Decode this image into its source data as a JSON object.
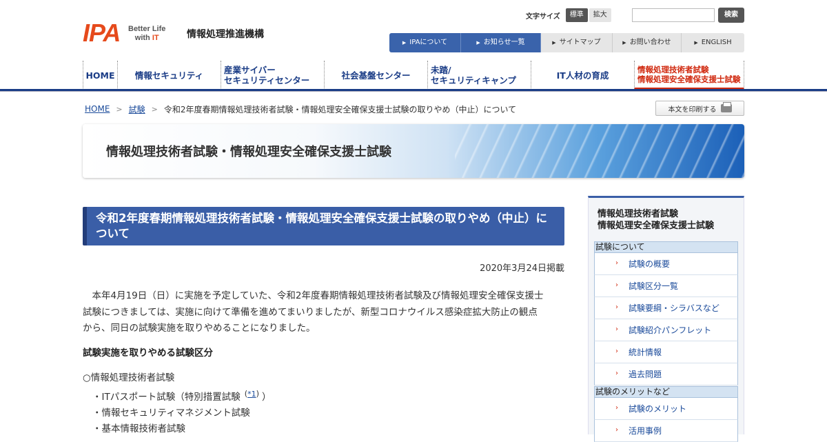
{
  "header": {
    "logo_mark": "IPA",
    "logo_tagline_1": "Better Life",
    "logo_tagline_2": "with",
    "logo_tagline_it": "IT",
    "org_name": "情報処理推進機構",
    "font_size_label": "文字サイズ",
    "font_standard": "標準",
    "font_large": "拡大",
    "search_placeholder": "",
    "search_button": "検索"
  },
  "top_nav": [
    {
      "label": "IPAについて",
      "active": true
    },
    {
      "label": "お知らせ一覧",
      "active": true
    },
    {
      "label": "サイトマップ",
      "active": false
    },
    {
      "label": "お問い合わせ",
      "active": false
    },
    {
      "label": "ENGLISH",
      "active": false
    }
  ],
  "main_nav": {
    "home": "HOME",
    "security": "情報セキュリティ",
    "cyber_1": "産業サイバー",
    "cyber_2": "セキュリティセンター",
    "infra": "社会基盤センター",
    "camp_1": "未踏/",
    "camp_2": "セキュリティキャンプ",
    "hr": "IT人材の育成",
    "exam_1": "情報処理技術者試験",
    "exam_2": "情報処理安全確保支援士試験"
  },
  "breadcrumb": {
    "home": "HOME",
    "exam": "試験",
    "current": "令和2年度春期情報処理技術者試験・情報処理安全確保支援士試験の取りやめ（中止）について"
  },
  "print_button": "本文を印刷する",
  "banner_title": "情報処理技術者試験・情報処理安全確保支援士試験",
  "article": {
    "heading_1": "令和2年度春期情報処理技術者試験・情報処理安全確保支援士試験の取りやめ（中止）に",
    "heading_2": "ついて",
    "published": "2020年3月24日掲載",
    "paragraph_1": "　本年4月19日（日）に実施を予定していた、令和2年度春期情報処理技術者試験及び情報処理安全確保支援士",
    "paragraph_2": "試験につきましては、実施に向けて準備を進めてまいりましたが、新型コロナウイルス感染症拡大防止の観点",
    "paragraph_3": "から、同日の試験実施を取りやめることになりました。",
    "subheading": "試験実施を取りやめる試験区分",
    "category": "○情報処理技術者試験",
    "items": [
      {
        "text": "・ITパスポート試験（特別措置試験",
        "note": "*1",
        "close": "）"
      },
      {
        "text": "・情報セキュリティマネジメント試験",
        "note": "",
        "close": ""
      },
      {
        "text": "・基本情報技術者試験",
        "note": "",
        "close": ""
      }
    ]
  },
  "sidebar": {
    "title_1": "情報処理技術者試験",
    "title_2": "情報処理安全確保支援士試験",
    "section_1": "試験について",
    "section_1_items": [
      "試験の概要",
      "試験区分一覧",
      "試験要綱・シラバスなど",
      "試験紹介パンフレット",
      "統計情報",
      "過去問題"
    ],
    "section_2": "試験のメリットなど",
    "section_2_items": [
      "試験のメリット",
      "活用事例"
    ]
  },
  "colors": {
    "brand_orange": "#e64a1c",
    "nav_blue": "#1a3c86",
    "accent_red": "#d0280e",
    "heading_blue": "#3a5ea7"
  }
}
